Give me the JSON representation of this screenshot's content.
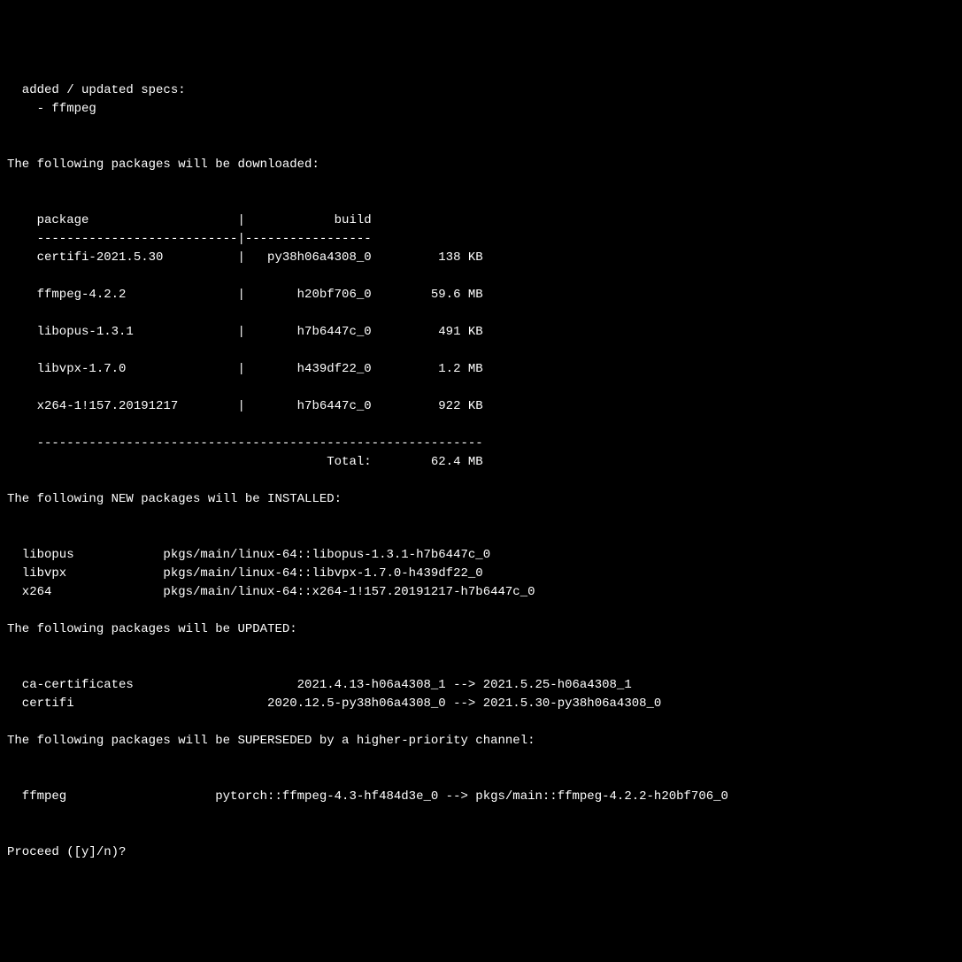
{
  "specs_header": "  added / updated specs:",
  "specs": {
    "items": [
      "- ffmpeg"
    ]
  },
  "download_section": {
    "header": "The following packages will be downloaded:",
    "table_header": "    package                    |            build",
    "table_divider": "    ---------------------------|-----------------",
    "rows": [
      "    certifi-2021.5.30          |   py38h06a4308_0         138 KB",
      "    ffmpeg-4.2.2               |       h20bf706_0        59.6 MB",
      "    libopus-1.3.1              |       h7b6447c_0         491 KB",
      "    libvpx-1.7.0               |       h439df22_0         1.2 MB",
      "    x264-1!157.20191217        |       h7b6447c_0         922 KB"
    ],
    "total_divider": "    ------------------------------------------------------------",
    "total_line": "                                           Total:        62.4 MB"
  },
  "install_section": {
    "header": "The following NEW packages will be INSTALLED:",
    "items": [
      "  libopus            pkgs/main/linux-64::libopus-1.3.1-h7b6447c_0",
      "  libvpx             pkgs/main/linux-64::libvpx-1.7.0-h439df22_0",
      "  x264               pkgs/main/linux-64::x264-1!157.20191217-h7b6447c_0"
    ]
  },
  "update_section": {
    "header": "The following packages will be UPDATED:",
    "items": [
      "  ca-certificates                      2021.4.13-h06a4308_1 --> 2021.5.25-h06a4308_1",
      "  certifi                          2020.12.5-py38h06a4308_0 --> 2021.5.30-py38h06a4308_0"
    ]
  },
  "supersede_section": {
    "header": "The following packages will be SUPERSEDED by a higher-priority channel:",
    "items": [
      "  ffmpeg                    pytorch::ffmpeg-4.3-hf484d3e_0 --> pkgs/main::ffmpeg-4.2.2-h20bf706_0"
    ]
  },
  "prompt": "Proceed ([y]/n)? "
}
